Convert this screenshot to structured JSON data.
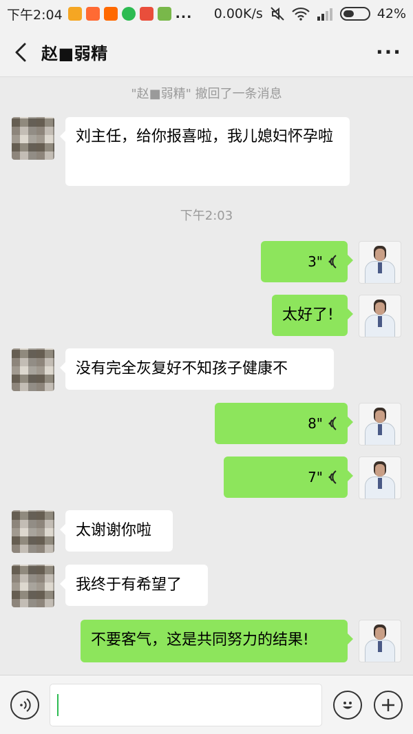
{
  "status_bar": {
    "time": "下午2:04",
    "dots": "...",
    "speed": "0.00K/s",
    "battery": "42%",
    "app_icons": [
      "orange-app-icon",
      "taobao-icon",
      "mi-icon",
      "wechat-icon",
      "red-app-icon",
      "green-app-icon"
    ],
    "colors": {
      "orange": "#f5a623",
      "taobao": "#ff6a33",
      "mi": "#ff6900",
      "wechat": "#2dbb52",
      "red": "#e94e3b",
      "green": "#79b84a"
    }
  },
  "header": {
    "title": "赵■弱精",
    "more": "···"
  },
  "chat": {
    "recall_notice": "\"赵■弱精\" 撤回了一条消息",
    "timestamp": "下午2:03",
    "messages": [
      {
        "from": "them",
        "text": "刘主任，给你报喜啦，我儿媳妇怀孕啦"
      },
      {
        "from": "me",
        "type": "voice",
        "duration": "3\""
      },
      {
        "from": "me",
        "text": "太好了!"
      },
      {
        "from": "them",
        "text": "没有完全灰复好不知孩子健康不"
      },
      {
        "from": "me",
        "type": "voice",
        "duration": "8\""
      },
      {
        "from": "me",
        "type": "voice",
        "duration": "7\""
      },
      {
        "from": "them",
        "text": "太谢谢你啦"
      },
      {
        "from": "them",
        "text": "我终于有希望了"
      },
      {
        "from": "me",
        "text": "不要客气，这是共同努力的结果!"
      }
    ]
  },
  "input_bar": {
    "value": "",
    "voice_button_icon": "voice-icon",
    "emoji_button_icon": "emoji-icon",
    "plus_button_icon": "plus-icon"
  },
  "colors": {
    "my_bubble": "#8de55c",
    "their_bubble": "#ffffff",
    "background": "#ebebeb"
  }
}
